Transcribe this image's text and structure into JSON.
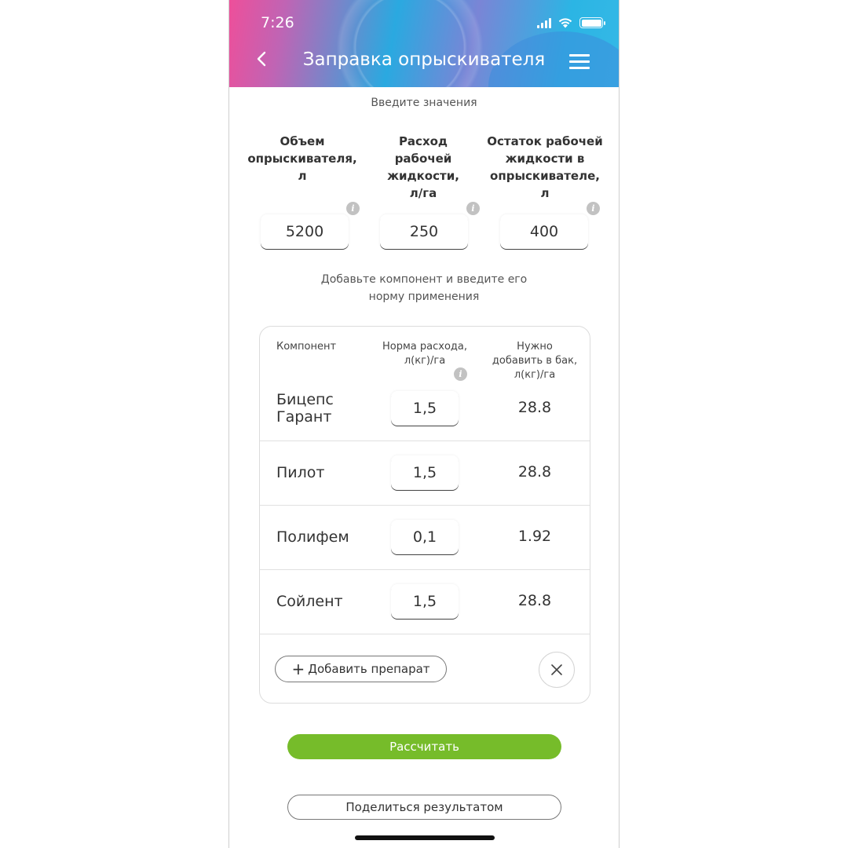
{
  "status_bar": {
    "time": "7:26"
  },
  "header": {
    "title": "Заправка опрыскивателя",
    "back_icon": "chevron-left-icon",
    "menu_icon": "hamburger-menu-icon"
  },
  "inputs_section": {
    "prompt": "Введите значения",
    "fields": [
      {
        "label": "Объем опрыскивателя, л",
        "value": "5200"
      },
      {
        "label": "Расход рабочей жидкости, л/га",
        "value": "250"
      },
      {
        "label": "Остаток рабочей жидкости в опрыскивателе, л",
        "value": "400"
      }
    ]
  },
  "components_section": {
    "prompt_line1": "Добавьте компонент и введите его",
    "prompt_line2": "норму применения",
    "columns": {
      "component": "Компонент",
      "rate_line1": "Норма расхода,",
      "rate_line2": "л(кг)/га",
      "need_line1": "Нужно",
      "need_line2": "добавить в бак,",
      "need_line3": "л(кг)/га"
    },
    "rows": [
      {
        "name_line1": "Бицепс",
        "name_line2": "Гарант",
        "rate": "1,5",
        "need": "28.8"
      },
      {
        "name_line1": "Пилот",
        "name_line2": "",
        "rate": "1,5",
        "need": "28.8"
      },
      {
        "name_line1": "Полифем",
        "name_line2": "",
        "rate": "0,1",
        "need": "1.92"
      },
      {
        "name_line1": "Сойлент",
        "name_line2": "",
        "rate": "1,5",
        "need": "28.8"
      }
    ],
    "add_button": "Добавить препарат"
  },
  "actions": {
    "calculate": "Рассчитать",
    "share": "Поделиться результатом"
  },
  "colors": {
    "accent_green": "#76bc2a",
    "header_pink": "#ee4f9a",
    "header_blue": "#2aa9e0"
  }
}
